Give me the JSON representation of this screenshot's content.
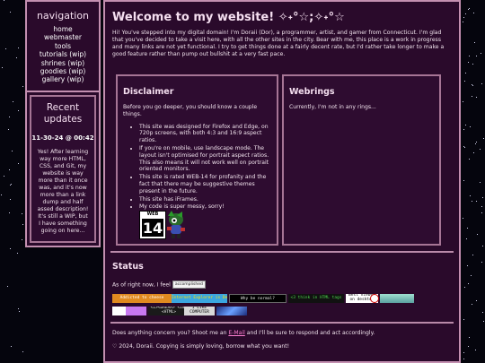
{
  "sidebar": {
    "title": "navigation",
    "items": [
      "home",
      "webmaster",
      "tools",
      "tutorials (wip)",
      "shrines (wip)",
      "goodies (wip)",
      "gallery (wip)"
    ]
  },
  "updates": {
    "title": "Recent updates",
    "date": "11-30-24 @ 00:42",
    "text": "Yes! After learning way more HTML, CSS, and Git, my website is way more than it once was, and it's now more than a link dump and half assed description! It's still a WIP, but I have something going on here..."
  },
  "header": {
    "title": "Welcome to my website! ✧˖°☆;✧˖°☆",
    "intro": "Hi! You've stepped into my digital domain! I'm Doraii (Dor), a programmer, artist, and gamer from Connecticut. I'm glad that you've decided to take a visit here, with all the other sites in the city. Bear with me, this place is a work in progress and many links are not yet functional. I try to get things done at a fairly decent rate, but I'd rather take longer to make a good feature rather than pump out bullshit at a very fast pace."
  },
  "disclaimer": {
    "title": "Disclaimer",
    "lead": "Before you go deeper, you should know a couple things.",
    "items": [
      "This site was designed for Firefox and Edge, on 720p screens, with both 4:3 and 16:9 aspect ratios.",
      "If you're on mobile, use landscape mode. The layout isn't optimised for portrait aspect ratios. This also means it will not work well on portrait oriented monitors.",
      "This site is rated WEB-14 for profanity and the fact that there may be suggestive themes present in the future.",
      "This site has iFrames.",
      "My code is super messy, sorry!"
    ],
    "rating_top": "WEB",
    "rating_num": "14"
  },
  "webrings": {
    "title": "Webrings",
    "text": "Currently, I'm not in any rings..."
  },
  "status": {
    "title": "Status",
    "feel_prefix": "As of right now, I feel",
    "feel_badge": "accomplished"
  },
  "badges": [
    "Addicted to cheese",
    "Internet Explorer is Dead",
    "Why be normal?",
    "<3 think in HTML tags",
    "Best viewed on desktop",
    "",
    "",
    "",
    "<I><DREAM> <IN><HTML>",
    "I LIKE COMPUTER",
    ""
  ],
  "footer": {
    "contact_prefix": "Does anything concern you? Shoot me an",
    "contact_link": "E-Mail",
    "contact_suffix": "and I'll be sure to respond and act accordingly.",
    "copyright": "♡ 2024, Doraii. Copying is simply loving, borrow what you want!"
  },
  "colors": {
    "background": "#05050d",
    "panel": "#2a0a2b",
    "border": "#c38fb0",
    "link": "#ff7fd1"
  }
}
